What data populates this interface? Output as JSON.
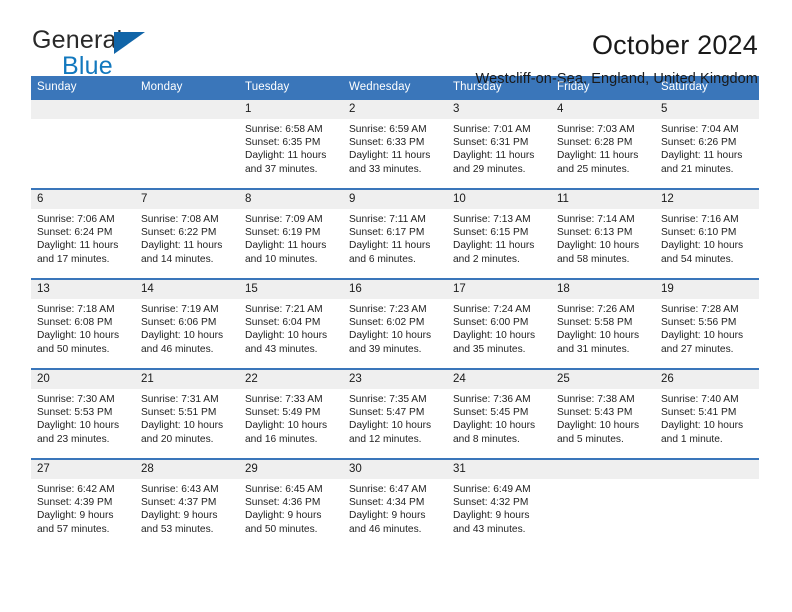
{
  "brand": {
    "name_part1": "General",
    "name_part2": "Blue",
    "triangle_color": "#1165a8",
    "blue_color": "#1278be"
  },
  "header": {
    "title": "October 2024",
    "subtitle": "Westcliff-on-Sea, England, United Kingdom"
  },
  "theme": {
    "header_blue": "#3a76ba",
    "date_band_gray": "#efefef"
  },
  "weekday_headers": [
    "Sunday",
    "Monday",
    "Tuesday",
    "Wednesday",
    "Thursday",
    "Friday",
    "Saturday"
  ],
  "labels": {
    "sunrise_prefix": "Sunrise:",
    "sunset_prefix": "Sunset:",
    "daylight_prefix": "Daylight:"
  },
  "weeks": [
    [
      {
        "day": "",
        "sunrise": "",
        "sunset": "",
        "daylight": ""
      },
      {
        "day": "",
        "sunrise": "",
        "sunset": "",
        "daylight": ""
      },
      {
        "day": "1",
        "sunrise": "Sunrise: 6:58 AM",
        "sunset": "Sunset: 6:35 PM",
        "daylight": "Daylight: 11 hours and 37 minutes."
      },
      {
        "day": "2",
        "sunrise": "Sunrise: 6:59 AM",
        "sunset": "Sunset: 6:33 PM",
        "daylight": "Daylight: 11 hours and 33 minutes."
      },
      {
        "day": "3",
        "sunrise": "Sunrise: 7:01 AM",
        "sunset": "Sunset: 6:31 PM",
        "daylight": "Daylight: 11 hours and 29 minutes."
      },
      {
        "day": "4",
        "sunrise": "Sunrise: 7:03 AM",
        "sunset": "Sunset: 6:28 PM",
        "daylight": "Daylight: 11 hours and 25 minutes."
      },
      {
        "day": "5",
        "sunrise": "Sunrise: 7:04 AM",
        "sunset": "Sunset: 6:26 PM",
        "daylight": "Daylight: 11 hours and 21 minutes."
      }
    ],
    [
      {
        "day": "6",
        "sunrise": "Sunrise: 7:06 AM",
        "sunset": "Sunset: 6:24 PM",
        "daylight": "Daylight: 11 hours and 17 minutes."
      },
      {
        "day": "7",
        "sunrise": "Sunrise: 7:08 AM",
        "sunset": "Sunset: 6:22 PM",
        "daylight": "Daylight: 11 hours and 14 minutes."
      },
      {
        "day": "8",
        "sunrise": "Sunrise: 7:09 AM",
        "sunset": "Sunset: 6:19 PM",
        "daylight": "Daylight: 11 hours and 10 minutes."
      },
      {
        "day": "9",
        "sunrise": "Sunrise: 7:11 AM",
        "sunset": "Sunset: 6:17 PM",
        "daylight": "Daylight: 11 hours and 6 minutes."
      },
      {
        "day": "10",
        "sunrise": "Sunrise: 7:13 AM",
        "sunset": "Sunset: 6:15 PM",
        "daylight": "Daylight: 11 hours and 2 minutes."
      },
      {
        "day": "11",
        "sunrise": "Sunrise: 7:14 AM",
        "sunset": "Sunset: 6:13 PM",
        "daylight": "Daylight: 10 hours and 58 minutes."
      },
      {
        "day": "12",
        "sunrise": "Sunrise: 7:16 AM",
        "sunset": "Sunset: 6:10 PM",
        "daylight": "Daylight: 10 hours and 54 minutes."
      }
    ],
    [
      {
        "day": "13",
        "sunrise": "Sunrise: 7:18 AM",
        "sunset": "Sunset: 6:08 PM",
        "daylight": "Daylight: 10 hours and 50 minutes."
      },
      {
        "day": "14",
        "sunrise": "Sunrise: 7:19 AM",
        "sunset": "Sunset: 6:06 PM",
        "daylight": "Daylight: 10 hours and 46 minutes."
      },
      {
        "day": "15",
        "sunrise": "Sunrise: 7:21 AM",
        "sunset": "Sunset: 6:04 PM",
        "daylight": "Daylight: 10 hours and 43 minutes."
      },
      {
        "day": "16",
        "sunrise": "Sunrise: 7:23 AM",
        "sunset": "Sunset: 6:02 PM",
        "daylight": "Daylight: 10 hours and 39 minutes."
      },
      {
        "day": "17",
        "sunrise": "Sunrise: 7:24 AM",
        "sunset": "Sunset: 6:00 PM",
        "daylight": "Daylight: 10 hours and 35 minutes."
      },
      {
        "day": "18",
        "sunrise": "Sunrise: 7:26 AM",
        "sunset": "Sunset: 5:58 PM",
        "daylight": "Daylight: 10 hours and 31 minutes."
      },
      {
        "day": "19",
        "sunrise": "Sunrise: 7:28 AM",
        "sunset": "Sunset: 5:56 PM",
        "daylight": "Daylight: 10 hours and 27 minutes."
      }
    ],
    [
      {
        "day": "20",
        "sunrise": "Sunrise: 7:30 AM",
        "sunset": "Sunset: 5:53 PM",
        "daylight": "Daylight: 10 hours and 23 minutes."
      },
      {
        "day": "21",
        "sunrise": "Sunrise: 7:31 AM",
        "sunset": "Sunset: 5:51 PM",
        "daylight": "Daylight: 10 hours and 20 minutes."
      },
      {
        "day": "22",
        "sunrise": "Sunrise: 7:33 AM",
        "sunset": "Sunset: 5:49 PM",
        "daylight": "Daylight: 10 hours and 16 minutes."
      },
      {
        "day": "23",
        "sunrise": "Sunrise: 7:35 AM",
        "sunset": "Sunset: 5:47 PM",
        "daylight": "Daylight: 10 hours and 12 minutes."
      },
      {
        "day": "24",
        "sunrise": "Sunrise: 7:36 AM",
        "sunset": "Sunset: 5:45 PM",
        "daylight": "Daylight: 10 hours and 8 minutes."
      },
      {
        "day": "25",
        "sunrise": "Sunrise: 7:38 AM",
        "sunset": "Sunset: 5:43 PM",
        "daylight": "Daylight: 10 hours and 5 minutes."
      },
      {
        "day": "26",
        "sunrise": "Sunrise: 7:40 AM",
        "sunset": "Sunset: 5:41 PM",
        "daylight": "Daylight: 10 hours and 1 minute."
      }
    ],
    [
      {
        "day": "27",
        "sunrise": "Sunrise: 6:42 AM",
        "sunset": "Sunset: 4:39 PM",
        "daylight": "Daylight: 9 hours and 57 minutes."
      },
      {
        "day": "28",
        "sunrise": "Sunrise: 6:43 AM",
        "sunset": "Sunset: 4:37 PM",
        "daylight": "Daylight: 9 hours and 53 minutes."
      },
      {
        "day": "29",
        "sunrise": "Sunrise: 6:45 AM",
        "sunset": "Sunset: 4:36 PM",
        "daylight": "Daylight: 9 hours and 50 minutes."
      },
      {
        "day": "30",
        "sunrise": "Sunrise: 6:47 AM",
        "sunset": "Sunset: 4:34 PM",
        "daylight": "Daylight: 9 hours and 46 minutes."
      },
      {
        "day": "31",
        "sunrise": "Sunrise: 6:49 AM",
        "sunset": "Sunset: 4:32 PM",
        "daylight": "Daylight: 9 hours and 43 minutes."
      },
      {
        "day": "",
        "sunrise": "",
        "sunset": "",
        "daylight": ""
      },
      {
        "day": "",
        "sunrise": "",
        "sunset": "",
        "daylight": ""
      }
    ]
  ]
}
